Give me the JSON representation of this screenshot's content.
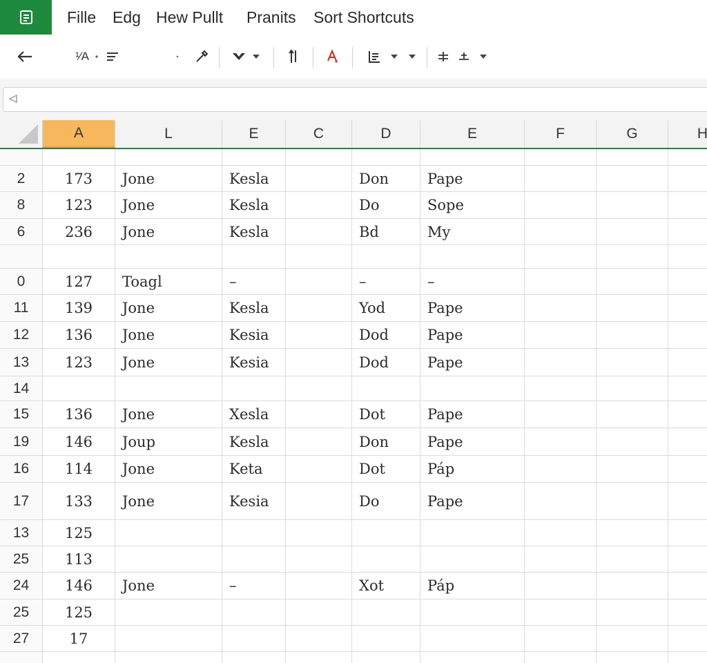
{
  "menu": {
    "items": [
      "Fille",
      "Edg",
      "Hew Pullt",
      "Pranits",
      "Sort Shortcuts"
    ]
  },
  "toolbar": {
    "font_size_label": "¹⁄A",
    "icons": [
      "back-arrow-icon",
      "align-icon",
      "eyedropper-icon",
      "fill-icon",
      "sort-icon",
      "text-color-icon",
      "borders-icon",
      "merge-icon"
    ]
  },
  "formula": {
    "value": ""
  },
  "columns": [
    "A",
    "L",
    "E",
    "C",
    "D",
    "E",
    "F",
    "G",
    "H"
  ],
  "rows": [
    {
      "n": "",
      "c": [
        "",
        "",
        "",
        "",
        "",
        ""
      ]
    },
    {
      "n": "2",
      "c": [
        "173",
        "Jone",
        "Kesla",
        "",
        "Don",
        "Pape"
      ]
    },
    {
      "n": "8",
      "c": [
        "123",
        "Jone",
        "Kesla",
        "",
        "Do",
        "Sope"
      ]
    },
    {
      "n": "6",
      "c": [
        "236",
        "Jone",
        "Kesla",
        "",
        "Bd",
        "My"
      ]
    },
    {
      "n": "",
      "c": [
        "",
        "",
        "",
        "",
        "",
        ""
      ]
    },
    {
      "n": "0",
      "c": [
        "127",
        "Toagl",
        "–",
        "",
        "–",
        "–"
      ]
    },
    {
      "n": "11",
      "c": [
        "139",
        "Jone",
        "Kesla",
        "",
        "Yod",
        "Pape"
      ]
    },
    {
      "n": "12",
      "c": [
        "136",
        "Jone",
        "Kesia",
        "",
        "Dod",
        "Pape"
      ]
    },
    {
      "n": "13",
      "c": [
        "123",
        "Jone",
        "Kesia",
        "",
        "Dod",
        "Pape"
      ]
    },
    {
      "n": "14",
      "c": [
        "",
        "",
        "",
        "",
        "",
        ""
      ]
    },
    {
      "n": "15",
      "c": [
        "136",
        "Jone",
        "Xesla",
        "",
        "Dot",
        "Pape"
      ]
    },
    {
      "n": "19",
      "c": [
        "146",
        "Joup",
        "Kesla",
        "",
        "Don",
        "Pape"
      ]
    },
    {
      "n": "16",
      "c": [
        "114",
        "Jone",
        "Keta",
        "",
        "Dot",
        "Páp"
      ]
    },
    {
      "n": "17",
      "c": [
        "133",
        "Jone",
        "Kesia",
        "",
        "Do",
        "Pape"
      ]
    },
    {
      "n": "13",
      "c": [
        "125",
        "",
        "",
        "",
        "",
        ""
      ]
    },
    {
      "n": "25",
      "c": [
        "113",
        "",
        "",
        "",
        "",
        ""
      ]
    },
    {
      "n": "24",
      "c": [
        "146",
        "Jone",
        "–",
        "",
        "Xot",
        "Páp"
      ]
    },
    {
      "n": "25",
      "c": [
        "125",
        "",
        "",
        "",
        "",
        ""
      ]
    },
    {
      "n": "27",
      "c": [
        "17",
        "",
        "",
        "",
        "",
        ""
      ]
    },
    {
      "n": "",
      "c": [
        "",
        "",
        "",
        "",
        "",
        ""
      ]
    }
  ]
}
